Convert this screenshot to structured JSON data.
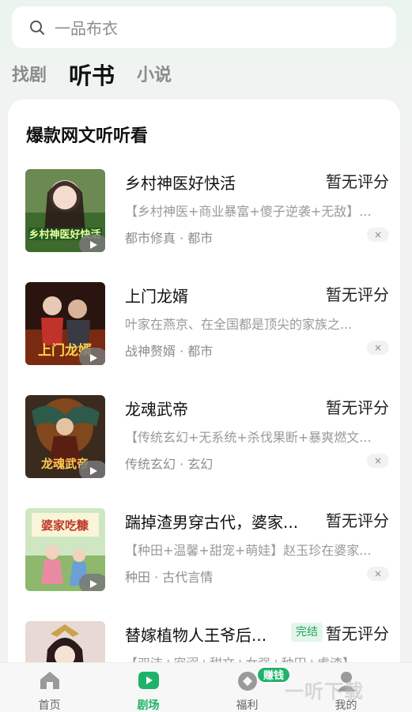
{
  "search": {
    "placeholder": "一品布衣"
  },
  "tabs": [
    {
      "label": "找剧",
      "active": false
    },
    {
      "label": "听书",
      "active": true
    },
    {
      "label": "小说",
      "active": false
    }
  ],
  "section": {
    "title": "爆款网文听听看"
  },
  "books": [
    {
      "title": "乡村神医好快活",
      "rating": "暂无评分",
      "desc": "【乡村神医+商业暴富+傻子逆袭+无敌】...",
      "tags": "都市修真 · 都市",
      "cover_text": "乡村神医好快活"
    },
    {
      "title": "上门龙婿",
      "rating": "暂无评分",
      "desc": "叶家在燕京、在全国都是顶尖的家族之...",
      "tags": "战神赘婿 · 都市",
      "cover_text": "上门龙婿"
    },
    {
      "title": "龙魂武帝",
      "rating": "暂无评分",
      "desc": "【传统玄幻+无系统+杀伐果断+暴爽燃文...",
      "tags": "传统玄幻 · 玄幻",
      "cover_text": "龙魂武帝"
    },
    {
      "title": "踹掉渣男穿古代，婆家...",
      "rating": "暂无评分",
      "desc": "【种田+温馨+甜宠+萌娃】赵玉珍在婆家...",
      "tags": "种田 · 古代言情",
      "cover_text": "婆家吃糠"
    },
    {
      "title": "替嫁植物人王爷后...",
      "rating": "暂无评分",
      "badge": "完结",
      "desc": "【双洁+宠溺+甜文+女强+种田+虐渣】",
      "tags": "",
      "cover_text": ""
    }
  ],
  "bottom_nav": [
    {
      "label": "首页",
      "icon": "home-icon",
      "active": false
    },
    {
      "label": "剧场",
      "icon": "theater-play-icon",
      "active": true
    },
    {
      "label": "福利",
      "icon": "coin-icon",
      "active": false,
      "badge": "赚钱"
    },
    {
      "label": "我的",
      "icon": "user-icon",
      "active": false
    }
  ],
  "watermark": "一听下载",
  "colors": {
    "accent": "#1fb36a",
    "background": "#f2f2f2"
  }
}
